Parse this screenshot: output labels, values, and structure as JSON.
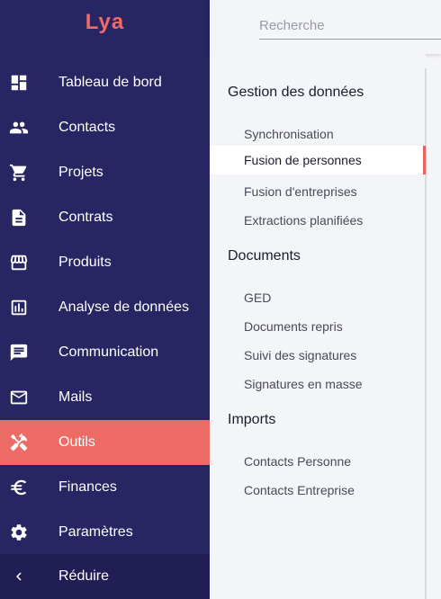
{
  "app": {
    "logo_text": "Lya",
    "brand_color": "#ec6b65",
    "sidebar_color": "#272562"
  },
  "search": {
    "placeholder": "Recherche"
  },
  "sidebar": {
    "items": [
      {
        "label": "Tableau de bord",
        "icon": "dashboard-icon"
      },
      {
        "label": "Contacts",
        "icon": "people-icon"
      },
      {
        "label": "Projets",
        "icon": "cart-icon"
      },
      {
        "label": "Contrats",
        "icon": "document-icon"
      },
      {
        "label": "Produits",
        "icon": "store-icon"
      },
      {
        "label": "Analyse de données",
        "icon": "analytics-icon"
      },
      {
        "label": "Communication",
        "icon": "chat-icon"
      },
      {
        "label": "Mails",
        "icon": "mail-icon"
      },
      {
        "label": "Outils",
        "icon": "tools-icon",
        "active": true
      },
      {
        "label": "Finances",
        "icon": "euro-icon"
      },
      {
        "label": "Paramètres",
        "icon": "gear-icon"
      }
    ],
    "collapse_label": "Réduire"
  },
  "panel": {
    "sections": [
      {
        "title": "Gestion des données",
        "items": [
          "Synchronisation",
          "Fusion de personnes",
          "Fusion d'entreprises",
          "Extractions planifiées"
        ]
      },
      {
        "title": "Documents",
        "items": [
          "GED",
          "Documents repris",
          "Suivi des signatures",
          "Signatures en masse"
        ]
      },
      {
        "title": "Imports",
        "items": [
          "Contacts Personne",
          "Contacts Entreprise"
        ]
      }
    ],
    "selected_item": "Fusion de personnes"
  }
}
